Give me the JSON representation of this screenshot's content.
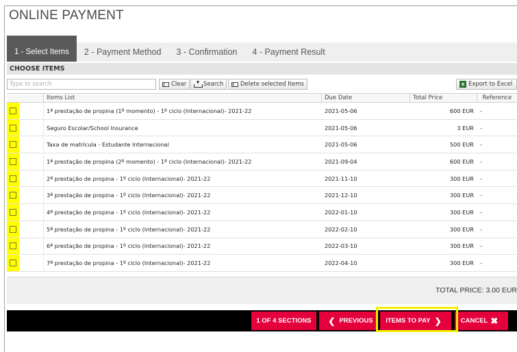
{
  "page_title": "ONLINE PAYMENT",
  "tabs": [
    {
      "label": "1 - Select Items",
      "active": true
    },
    {
      "label": "2 - Payment Method",
      "active": false
    },
    {
      "label": "3 - Confirmation",
      "active": false
    },
    {
      "label": "4 - Payment Result",
      "active": false
    }
  ],
  "section_title": "CHOOSE ITEMS",
  "toolbar": {
    "search_placeholder": "Type to search",
    "clear_label": "Clear",
    "search_label": "Search",
    "delete_label": "Delete selected Items",
    "export_label": "Export to Excel"
  },
  "grid": {
    "headers": {
      "items": "Items List",
      "due_date": "Due Date",
      "total_price": "Total Price",
      "reference": "Reference"
    },
    "rows": [
      {
        "item": "1ª prestação de propina (1º momento) - 1º ciclo (Internacional)- 2021-22",
        "due": "2021-05-06",
        "price": "600 EUR",
        "ref": "-"
      },
      {
        "item": "Seguro Escolar/School Insurance",
        "due": "2021-05-06",
        "price": "3 EUR",
        "ref": "-"
      },
      {
        "item": "Taxa de matrícula - Estudante Internacional",
        "due": "2021-05-06",
        "price": "500 EUR",
        "ref": "-"
      },
      {
        "item": "1ª prestação de propina (2º momento) - 1º ciclo (Internacional)- 2021-22",
        "due": "2021-09-04",
        "price": "600 EUR",
        "ref": "-"
      },
      {
        "item": "2ª prestação de propina - 1º ciclo (Internacional)- 2021-22",
        "due": "2021-11-10",
        "price": "300 EUR",
        "ref": "-"
      },
      {
        "item": "3ª prestação de propina - 1º ciclo (Internacional)- 2021-22",
        "due": "2021-12-10",
        "price": "300 EUR",
        "ref": "-"
      },
      {
        "item": "4ª prestação de propina - 1º ciclo (Internacional)- 2021-22",
        "due": "2022-01-10",
        "price": "300 EUR",
        "ref": "-"
      },
      {
        "item": "5ª prestação de propina - 1º ciclo (Internacional)- 2021-22",
        "due": "2022-02-10",
        "price": "300 EUR",
        "ref": "-"
      },
      {
        "item": "6ª prestação de propina - 1º ciclo (Internacional)- 2021-22",
        "due": "2022-03-10",
        "price": "300 EUR",
        "ref": "-"
      },
      {
        "item": "7ª prestação de propina - 1º ciclo (Internacional)- 2021-22",
        "due": "2022-04-10",
        "price": "300 EUR",
        "ref": "-"
      }
    ]
  },
  "total": "TOTAL PRICE: 3.00 EUR",
  "footer": {
    "sections_label": "1 OF 4 SECTIONS",
    "previous_label": "PREVIOUS",
    "items_to_pay_label": "ITEMS TO PAY",
    "cancel_label": "CANCEL"
  },
  "colors": {
    "accent": "#e4003b",
    "highlight": "#ffff00",
    "active_tab": "#5a5a5a"
  }
}
